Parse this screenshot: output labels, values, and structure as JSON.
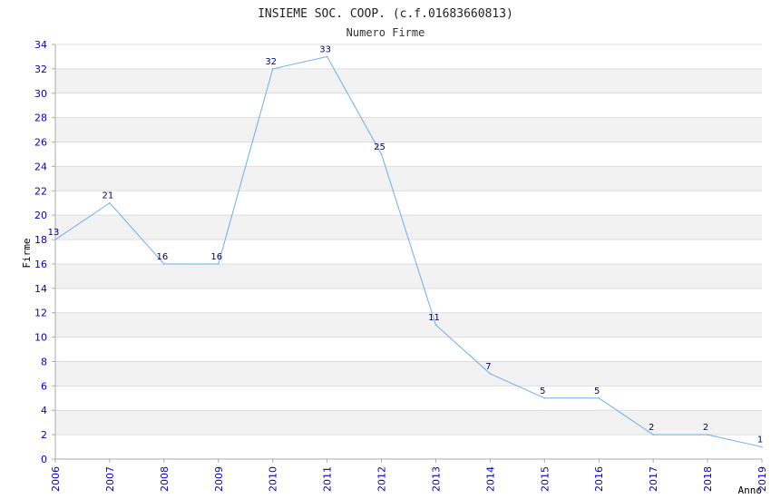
{
  "colors": {
    "line": "#6aaef0",
    "tick_labels": "#0000cc",
    "data_labels": "#000066",
    "band_alt": "#f2f2f2",
    "band": "#ffffff",
    "grid": "#dddddd",
    "axis": "#aaaaaa"
  },
  "chart_data": {
    "type": "line",
    "title": "INSIEME SOC. COOP. (c.f.01683660813)",
    "subtitle": "Numero Firme",
    "xlabel": "Anno",
    "ylabel": "Firme",
    "x": [
      2006,
      2007,
      2008,
      2009,
      2010,
      2011,
      2012,
      2013,
      2014,
      2015,
      2016,
      2017,
      2018,
      2019
    ],
    "x_tick_labels": [
      "2006",
      "2007",
      "2008",
      "2009",
      "2010",
      "2011",
      "2012",
      "2013",
      "2014",
      "2015",
      "2016",
      "2017",
      "2018",
      "2019"
    ],
    "series": [
      {
        "values": [
          18,
          21,
          16,
          16,
          32,
          33,
          25,
          11,
          7,
          5,
          5,
          2,
          2,
          1
        ],
        "data_labels": [
          "13",
          "21",
          "16",
          "16",
          "32",
          "33",
          "25",
          "11",
          "7",
          "5",
          "5",
          "2",
          "2",
          "1"
        ]
      }
    ],
    "ylim": [
      0,
      34
    ],
    "y_ticks": [
      0,
      2,
      4,
      6,
      8,
      10,
      12,
      14,
      16,
      18,
      20,
      22,
      24,
      26,
      28,
      30,
      32,
      34
    ],
    "grid": true,
    "legend": "none"
  }
}
